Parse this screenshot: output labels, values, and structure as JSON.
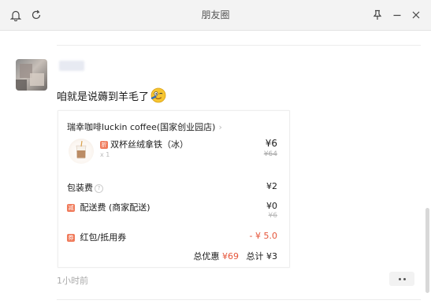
{
  "window": {
    "title": "朋友圈"
  },
  "post": {
    "text": "咱就是说薅到羊毛了",
    "time": "1小时前"
  },
  "order_card": {
    "store_name": "瑞幸咖啡luckin coffee(国家创业园店)",
    "product": {
      "tag": "折",
      "name": "双杯丝绒拿铁（冰）",
      "quantity": "x 1",
      "price": "¥6",
      "original_price": "¥64"
    },
    "packaging": {
      "label": "包装费",
      "value": "¥2"
    },
    "delivery": {
      "tag": "减",
      "label": "配送费 (商家配送)",
      "value": "¥0",
      "original_value": "¥6"
    },
    "coupon": {
      "tag": "券",
      "label": "红包/抵用券",
      "value": "- ¥ 5.0"
    },
    "summary": {
      "discount_label": "总优惠",
      "discount_value": "¥69",
      "total_label": "总计",
      "total_value": "¥3"
    }
  },
  "icons": {
    "bell": "bell-icon",
    "refresh": "refresh-icon",
    "pin": "pin-icon",
    "minimize": "minimize-icon",
    "close": "close-icon",
    "more": "more-icon",
    "emoji": "wink-emoji-icon"
  },
  "colors": {
    "accent_red": "#e5553a",
    "tag_orange": "#f07a5a",
    "muted": "#aaaaaa"
  }
}
